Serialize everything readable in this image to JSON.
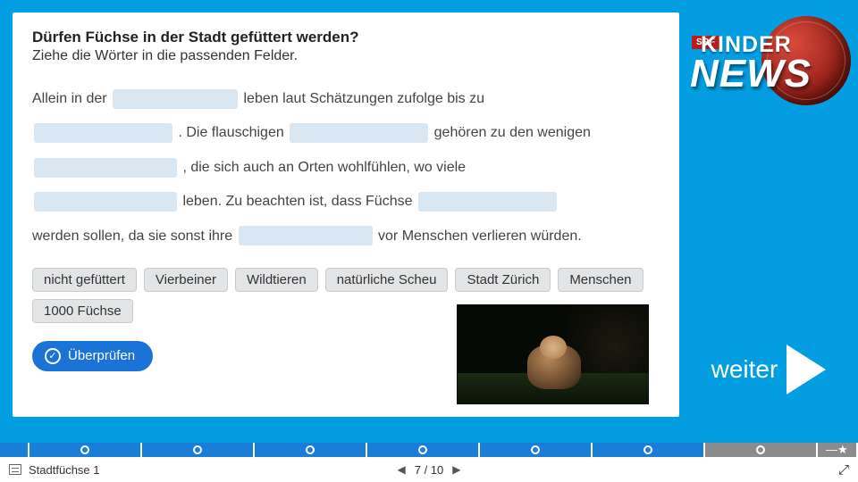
{
  "logo": {
    "srf": "SRF",
    "kinder": "KINDER",
    "news": "NEWS"
  },
  "question": "Dürfen Füchse in der Stadt gefüttert werden?",
  "instruction": "Ziehe die Wörter in die passenden Felder.",
  "cloze": {
    "t1": "Allein in der ",
    "t2": " leben laut Schätzungen zufolge bis zu ",
    "t3": ". Die flauschigen ",
    "t4": " gehören zu den wenigen ",
    "t5": ", die sich auch an Orten wohlfühlen, wo viele ",
    "t6": " leben. Zu beachten ist, dass Füchse ",
    "t7": " werden sollen, da sie sonst ihre ",
    "t8": " vor Menschen verlieren würden."
  },
  "tokens": [
    "nicht gefüttert",
    "Vierbeiner",
    "Wildtieren",
    "natürliche Scheu",
    "Stadt Zürich",
    "Menschen",
    "1000 Füchse"
  ],
  "check_label": "Überprüfen",
  "next_label": "weiter",
  "footer": {
    "title": "Stadtfüchse 1",
    "page_current": "7",
    "page_sep": " / ",
    "page_total": "10"
  }
}
